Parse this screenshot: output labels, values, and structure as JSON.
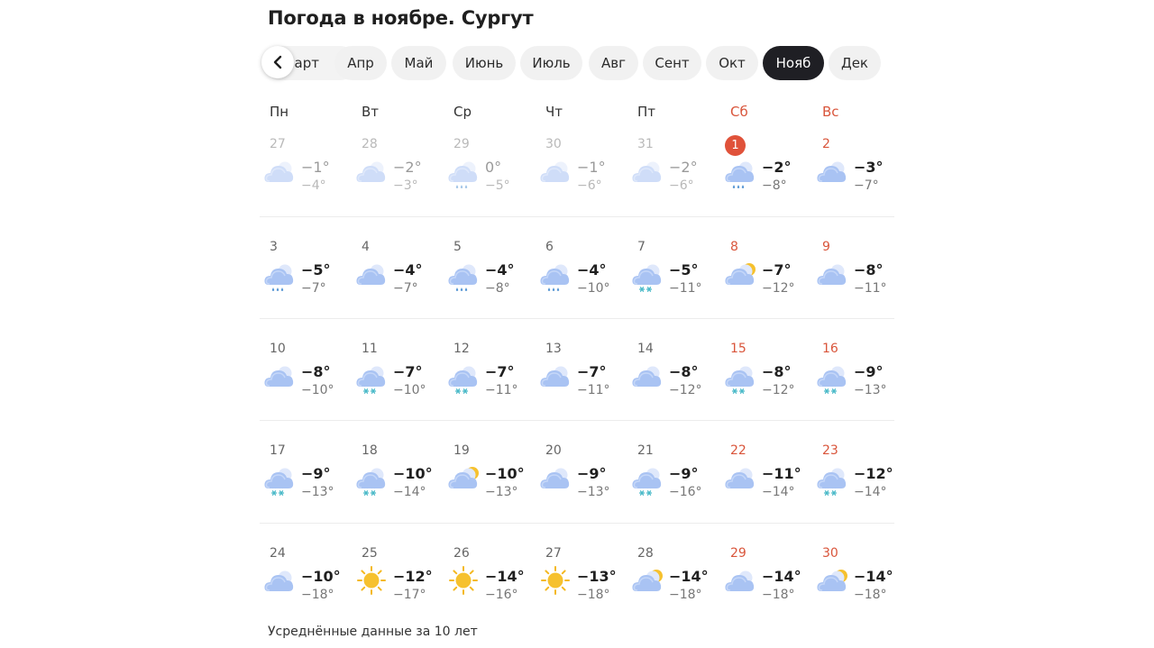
{
  "title": "Погода в ноябре. Сургут",
  "months": [
    {
      "label": "Март",
      "visible": "арт",
      "active": false
    },
    {
      "label": "Апр",
      "active": false
    },
    {
      "label": "Май",
      "active": false
    },
    {
      "label": "Июнь",
      "active": false
    },
    {
      "label": "Июль",
      "active": false
    },
    {
      "label": "Авг",
      "active": false
    },
    {
      "label": "Сент",
      "active": false
    },
    {
      "label": "Окт",
      "active": false
    },
    {
      "label": "Нояб",
      "active": true
    },
    {
      "label": "Дек",
      "active": false
    }
  ],
  "weekdays": [
    "Пн",
    "Вт",
    "Ср",
    "Чт",
    "Пт",
    "Сб",
    "Вс"
  ],
  "weeks": [
    [
      {
        "day": "27",
        "max": "−1°",
        "min": "−4°",
        "icon": "cloudy",
        "other_month": true
      },
      {
        "day": "28",
        "max": "−2°",
        "min": "−3°",
        "icon": "cloudy",
        "other_month": true
      },
      {
        "day": "29",
        "max": "0°",
        "min": "−5°",
        "icon": "cloud-rain",
        "other_month": true
      },
      {
        "day": "30",
        "max": "−1°",
        "min": "−6°",
        "icon": "cloudy",
        "other_month": true
      },
      {
        "day": "31",
        "max": "−2°",
        "min": "−6°",
        "icon": "cloudy",
        "other_month": true
      },
      {
        "day": "1",
        "max": "−2°",
        "min": "−8°",
        "icon": "cloud-rain",
        "today": true
      },
      {
        "day": "2",
        "max": "−3°",
        "min": "−7°",
        "icon": "cloudy"
      }
    ],
    [
      {
        "day": "3",
        "max": "−5°",
        "min": "−7°",
        "icon": "cloud-rain"
      },
      {
        "day": "4",
        "max": "−4°",
        "min": "−7°",
        "icon": "cloudy"
      },
      {
        "day": "5",
        "max": "−4°",
        "min": "−8°",
        "icon": "cloud-rain"
      },
      {
        "day": "6",
        "max": "−4°",
        "min": "−10°",
        "icon": "cloud-rain"
      },
      {
        "day": "7",
        "max": "−5°",
        "min": "−11°",
        "icon": "cloud-snow"
      },
      {
        "day": "8",
        "max": "−7°",
        "min": "−12°",
        "icon": "partly-cloudy"
      },
      {
        "day": "9",
        "max": "−8°",
        "min": "−11°",
        "icon": "cloudy"
      }
    ],
    [
      {
        "day": "10",
        "max": "−8°",
        "min": "−10°",
        "icon": "cloudy"
      },
      {
        "day": "11",
        "max": "−7°",
        "min": "−10°",
        "icon": "cloud-snow"
      },
      {
        "day": "12",
        "max": "−7°",
        "min": "−11°",
        "icon": "cloud-snow"
      },
      {
        "day": "13",
        "max": "−7°",
        "min": "−11°",
        "icon": "cloudy"
      },
      {
        "day": "14",
        "max": "−8°",
        "min": "−12°",
        "icon": "cloudy"
      },
      {
        "day": "15",
        "max": "−8°",
        "min": "−12°",
        "icon": "cloud-snow"
      },
      {
        "day": "16",
        "max": "−9°",
        "min": "−13°",
        "icon": "cloud-snow"
      }
    ],
    [
      {
        "day": "17",
        "max": "−9°",
        "min": "−13°",
        "icon": "cloud-snow"
      },
      {
        "day": "18",
        "max": "−10°",
        "min": "−14°",
        "icon": "cloud-snow"
      },
      {
        "day": "19",
        "max": "−10°",
        "min": "−13°",
        "icon": "partly-cloudy"
      },
      {
        "day": "20",
        "max": "−9°",
        "min": "−13°",
        "icon": "cloudy"
      },
      {
        "day": "21",
        "max": "−9°",
        "min": "−16°",
        "icon": "cloud-snow"
      },
      {
        "day": "22",
        "max": "−11°",
        "min": "−14°",
        "icon": "cloudy"
      },
      {
        "day": "23",
        "max": "−12°",
        "min": "−14°",
        "icon": "cloud-snow"
      }
    ],
    [
      {
        "day": "24",
        "max": "−10°",
        "min": "−18°",
        "icon": "cloudy"
      },
      {
        "day": "25",
        "max": "−12°",
        "min": "−17°",
        "icon": "sun"
      },
      {
        "day": "26",
        "max": "−14°",
        "min": "−16°",
        "icon": "sun"
      },
      {
        "day": "27",
        "max": "−13°",
        "min": "−18°",
        "icon": "sun"
      },
      {
        "day": "28",
        "max": "−14°",
        "min": "−18°",
        "icon": "partly-cloudy"
      },
      {
        "day": "29",
        "max": "−14°",
        "min": "−18°",
        "icon": "cloudy"
      },
      {
        "day": "30",
        "max": "−14°",
        "min": "−18°",
        "icon": "partly-cloudy"
      }
    ]
  ],
  "footer": "Усреднённые данные за 10 лет",
  "colors": {
    "weekend": "#d9553b",
    "today": "#e0523a",
    "active_chip": "#1f1f24",
    "chip": "#f1f1f1"
  }
}
